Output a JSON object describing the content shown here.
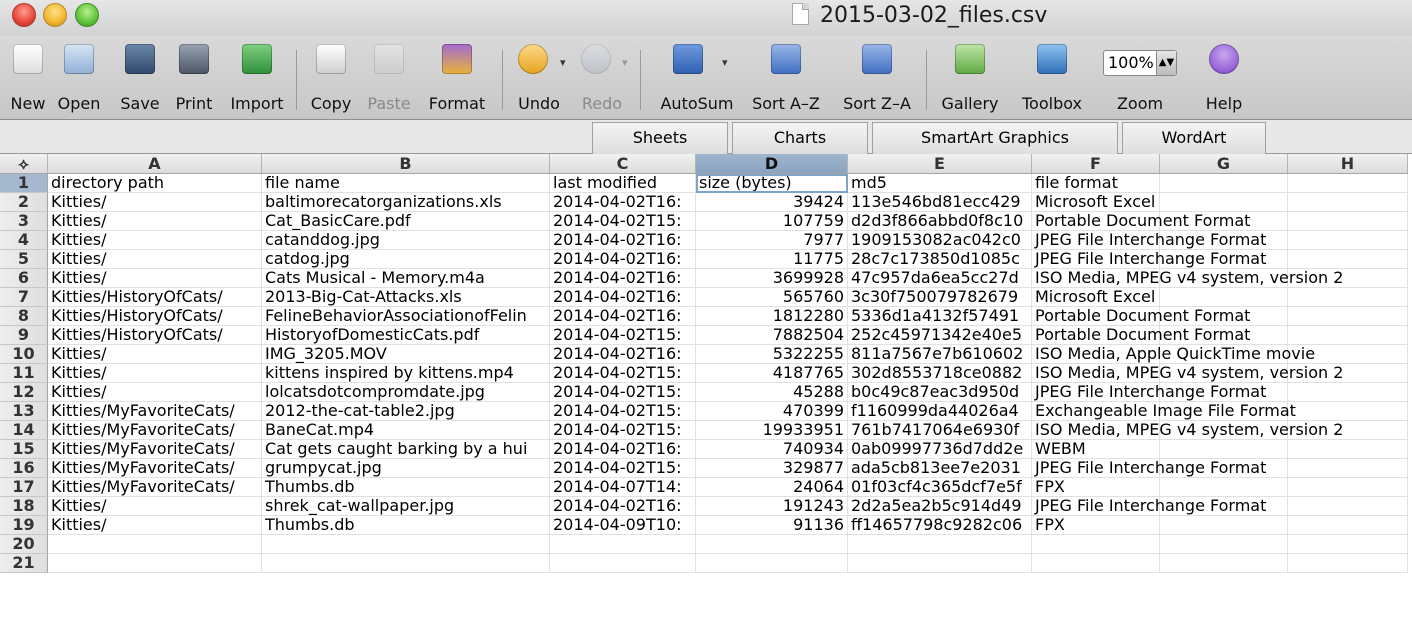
{
  "window": {
    "title": "2015-03-02_files.csv"
  },
  "toolbar": {
    "new": "New",
    "open": "Open",
    "save": "Save",
    "print": "Print",
    "import": "Import",
    "copy": "Copy",
    "paste": "Paste",
    "format": "Format",
    "undo": "Undo",
    "redo": "Redo",
    "autosum": "AutoSum",
    "sort_az": "Sort A–Z",
    "sort_za": "Sort Z–A",
    "gallery": "Gallery",
    "toolbox": "Toolbox",
    "zoom": "Zoom",
    "zoom_value": "100%",
    "help": "Help"
  },
  "ribbon": {
    "tabs": [
      "Sheets",
      "Charts",
      "SmartArt Graphics",
      "WordArt"
    ]
  },
  "grid": {
    "columns": [
      "A",
      "B",
      "C",
      "D",
      "E",
      "F",
      "G",
      "H"
    ],
    "selected_column": "D",
    "selected_row": "1",
    "rows": [
      [
        "1",
        "directory path",
        "file name",
        "last modified",
        "size (bytes)",
        "md5",
        "file format"
      ],
      [
        "2",
        "Kitties/",
        "baltimorecatorganizations.xls",
        "2014-04-02T16:",
        "39424",
        "113e546bd81ecc429",
        "Microsoft Excel"
      ],
      [
        "3",
        "Kitties/",
        "Cat_BasicCare.pdf",
        "2014-04-02T15:",
        "107759",
        "d2d3f866abbd0f8c10",
        "Portable Document Format"
      ],
      [
        "4",
        "Kitties/",
        "catanddog.jpg",
        "2014-04-02T16:",
        "7977",
        "1909153082ac042c0",
        "JPEG File Interchange Format"
      ],
      [
        "5",
        "Kitties/",
        "catdog.jpg",
        "2014-04-02T16:",
        "11775",
        "28c7c173850d1085c",
        "JPEG File Interchange Format"
      ],
      [
        "6",
        "Kitties/",
        "Cats Musical - Memory.m4a",
        "2014-04-02T16:",
        "3699928",
        "47c957da6ea5cc27d",
        "ISO Media, MPEG v4 system, version 2"
      ],
      [
        "7",
        "Kitties/HistoryOfCats/",
        "2013-Big-Cat-Attacks.xls",
        "2014-04-02T16:",
        "565760",
        "3c30f750079782679",
        "Microsoft Excel"
      ],
      [
        "8",
        "Kitties/HistoryOfCats/",
        "FelineBehaviorAssociationofFelin",
        "2014-04-02T16:",
        "1812280",
        "5336d1a4132f57491",
        "Portable Document Format"
      ],
      [
        "9",
        "Kitties/HistoryOfCats/",
        "HistoryofDomesticCats.pdf",
        "2014-04-02T15:",
        "7882504",
        "252c45971342e40e5",
        "Portable Document Format"
      ],
      [
        "10",
        "Kitties/",
        "IMG_3205.MOV",
        "2014-04-02T16:",
        "5322255",
        "811a7567e7b610602",
        "ISO Media, Apple QuickTime movie"
      ],
      [
        "11",
        "Kitties/",
        "kittens inspired by kittens.mp4",
        "2014-04-02T15:",
        "4187765",
        "302d8553718ce0882",
        "ISO Media, MPEG v4 system, version 2"
      ],
      [
        "12",
        "Kitties/",
        "lolcatsdotcompromdate.jpg",
        "2014-04-02T15:",
        "45288",
        "b0c49c87eac3d950d",
        "JPEG File Interchange Format"
      ],
      [
        "13",
        "Kitties/MyFavoriteCats/",
        "2012-the-cat-table2.jpg",
        "2014-04-02T15:",
        "470399",
        "f1160999da44026a4",
        "Exchangeable Image File Format"
      ],
      [
        "14",
        "Kitties/MyFavoriteCats/",
        "BaneCat.mp4",
        "2014-04-02T15:",
        "19933951",
        "761b7417064e6930f",
        "ISO Media, MPEG v4 system, version 2"
      ],
      [
        "15",
        "Kitties/MyFavoriteCats/",
        "Cat gets caught barking by a hui",
        "2014-04-02T16:",
        "740934",
        "0ab09997736d7dd2e",
        "WEBM"
      ],
      [
        "16",
        "Kitties/MyFavoriteCats/",
        "grumpycat.jpg",
        "2014-04-02T15:",
        "329877",
        "ada5cb813ee7e2031",
        "JPEG File Interchange Format"
      ],
      [
        "17",
        "Kitties/MyFavoriteCats/",
        "Thumbs.db",
        "2014-04-07T14:",
        "24064",
        "01f03cf4c365dcf7e5f",
        "FPX"
      ],
      [
        "18",
        "Kitties/",
        "shrek_cat-wallpaper.jpg",
        "2014-04-02T16:",
        "191243",
        "2d2a5ea2b5c914d49",
        "JPEG File Interchange Format"
      ],
      [
        "19",
        "Kitties/",
        "Thumbs.db",
        "2014-04-09T10:",
        "91136",
        "ff14657798c9282c06",
        "FPX"
      ],
      [
        "20"
      ],
      [
        "21"
      ]
    ]
  },
  "colors": {
    "selection": "#a5b8cd",
    "toolbar": "#d2d2d2"
  },
  "icons": [
    "new-icon",
    "open-icon",
    "save-icon",
    "print-icon",
    "import-icon",
    "copy-icon",
    "paste-icon",
    "format-icon",
    "undo-icon",
    "redo-icon",
    "autosum-icon",
    "sort-az-icon",
    "sort-za-icon",
    "gallery-icon",
    "toolbox-icon",
    "help-icon"
  ]
}
